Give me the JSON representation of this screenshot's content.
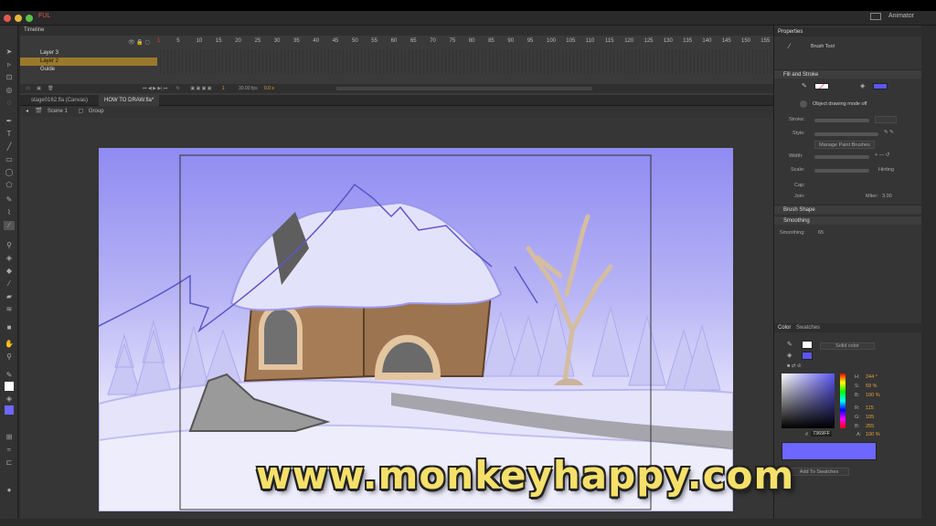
{
  "window": {
    "brand": "FUL",
    "app_name": "Animator"
  },
  "timeline": {
    "panel_title": "Timeline",
    "frame_numbers": [
      "1",
      "5",
      "10",
      "15",
      "20",
      "25",
      "30",
      "35",
      "40",
      "45",
      "50",
      "55",
      "60",
      "65",
      "70",
      "75",
      "80",
      "85",
      "90",
      "95",
      "100",
      "105",
      "110",
      "115",
      "120",
      "125",
      "130",
      "135",
      "140",
      "145",
      "150",
      "155"
    ],
    "layers": [
      {
        "name": "Layer 3",
        "selected": false
      },
      {
        "name": "Layer 2",
        "selected": true
      },
      {
        "name": "Guide",
        "selected": false
      }
    ],
    "current_frame": "1",
    "fps": "30.00 fps",
    "elapsed": "0.0 s"
  },
  "documents": {
    "tabs": [
      {
        "label": "stage0162.fla (Canvas)",
        "active": false
      },
      {
        "label": "HOW TO DRAW.fla*",
        "active": true
      }
    ]
  },
  "editbar": {
    "scene": "Scene 1",
    "group": "Group"
  },
  "properties": {
    "panel_title": "Properties",
    "tool_name": "Brush Tool",
    "fill_stroke_label": "Fill and Stroke",
    "fill_color": "#5b57f0",
    "object_drawing": "Object drawing mode off",
    "stroke_label": "Stroke:",
    "style_label": "Style:",
    "manage_brushes": "Manage Paint Brushes",
    "width_label": "Width:",
    "scale_label": "Scale:",
    "hinting_label": "Hinting",
    "cap_label": "Cap:",
    "join_label": "Join:",
    "miter_label": "Miter:",
    "miter_value": "3.00",
    "brush_shape_label": "Brush Shape",
    "smoothing_section": "Smoothing",
    "smoothing_label": "Smoothing:",
    "smoothing_value": "65"
  },
  "color_panel": {
    "tabs": [
      {
        "label": "Color"
      },
      {
        "label": "Swatches"
      }
    ],
    "fill_type": "Solid color",
    "h_label": "H:",
    "h_value": "244 °",
    "s_label": "S:",
    "s_value": "59 %",
    "b_label": "B:",
    "b_value": "100 %",
    "r_label": "R:",
    "r_value": "115",
    "g_label": "G:",
    "g_value": "105",
    "bl_label": "B:",
    "bl_value": "255",
    "hex_label": "#",
    "hex_value": "7369FF",
    "alpha_label": "A:",
    "alpha_value": "100 %",
    "current_color": "#6d66ff",
    "add_to_swatches": "Add To Swatches"
  },
  "watermark": "www.monkeyhappy.com"
}
